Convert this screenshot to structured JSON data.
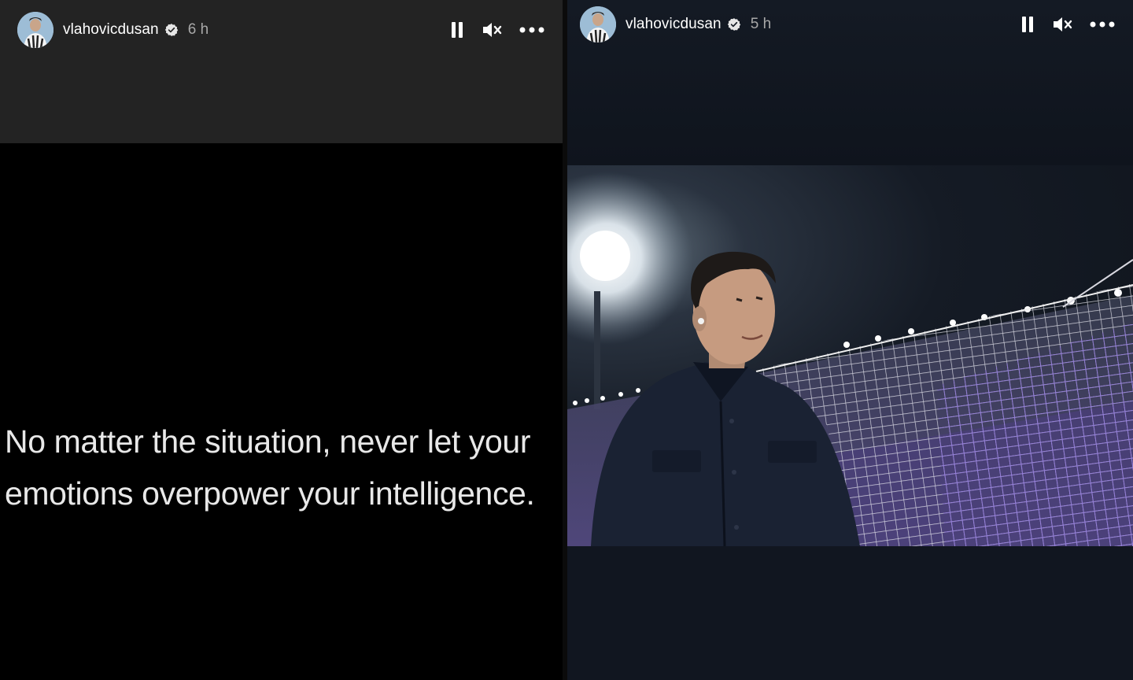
{
  "left_story": {
    "username": "vlahovicdusan",
    "timestamp": "6 h",
    "quote_line1": "No matter the situation, never let your",
    "quote_line2": "emotions overpower your intelligence."
  },
  "right_story": {
    "username": "vlahovicdusan",
    "timestamp": "5 h"
  },
  "icons": {
    "verified": "verified-badge-icon",
    "pause": "pause-icon",
    "mute": "muted-speaker-icon",
    "more": "more-options-icon"
  },
  "colors": {
    "left_header_bg": "#232323",
    "story_text": "#e8e8e8",
    "timestamp": "#a8a8a8",
    "right_bg": "#111620",
    "net_purple": "#8b6fe0"
  }
}
